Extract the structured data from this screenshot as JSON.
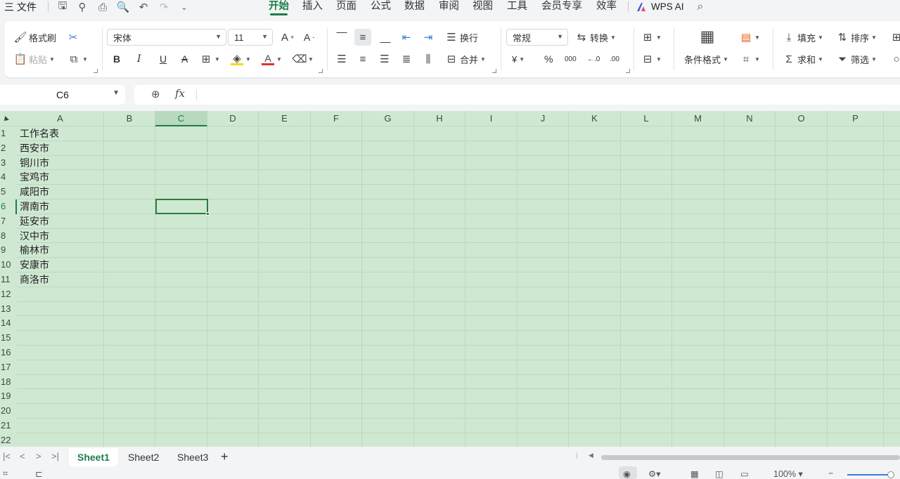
{
  "menubar": {
    "file_menu": "三 文件",
    "tabs": [
      "开始",
      "插入",
      "页面",
      "公式",
      "数据",
      "审阅",
      "视图",
      "工具",
      "会员专享",
      "效率"
    ],
    "active_tab": "开始",
    "wps_ai": "WPS AI"
  },
  "ribbon": {
    "format_painter": "格式刷",
    "paste": "粘贴",
    "font_name": "宋体",
    "font_size": "11",
    "bold": "B",
    "italic": "I",
    "underline": "U",
    "strike": "A",
    "wrap_text": "换行",
    "merge": "合并",
    "number_format": "常规",
    "convert": "转换",
    "currency": "¥",
    "percent": "%",
    "thousands": "000",
    "inc_decimal": "←.0",
    "dec_decimal": ".00",
    "cond_format": "条件格式",
    "fill": "填充",
    "sort": "排序",
    "sum": "求和",
    "filter": "筛选",
    "font_grow": "A",
    "font_shrink": "A"
  },
  "formula_bar": {
    "name_box": "C6",
    "fx": "fx",
    "value": ""
  },
  "grid": {
    "columns": [
      "A",
      "B",
      "C",
      "D",
      "E",
      "F",
      "G",
      "H",
      "I",
      "J",
      "K",
      "L",
      "M",
      "N",
      "O",
      "P"
    ],
    "selected_column": "C",
    "rows": [
      "1",
      "2",
      "3",
      "4",
      "5",
      "6",
      "7",
      "8",
      "9",
      "10",
      "11",
      "12",
      "13",
      "14",
      "15",
      "16",
      "17",
      "18",
      "19",
      "20",
      "21",
      "22"
    ],
    "selected_row": "6",
    "column_a": [
      "工作名表",
      "西安市",
      "铜川市",
      "宝鸡市",
      "咸阳市",
      "渭南市",
      "延安市",
      "汉中市",
      "榆林市",
      "安康市",
      "商洛市"
    ],
    "active_cell": "C6"
  },
  "sheets": {
    "tabs": [
      "Sheet1",
      "Sheet2",
      "Sheet3"
    ],
    "active": "Sheet1",
    "add": "+"
  },
  "status": {
    "zoom": "100%"
  },
  "colors": {
    "accent": "#1d7d4a",
    "sheet_bg": "#cfe8d2",
    "grid_line": "#bcd8c0"
  }
}
